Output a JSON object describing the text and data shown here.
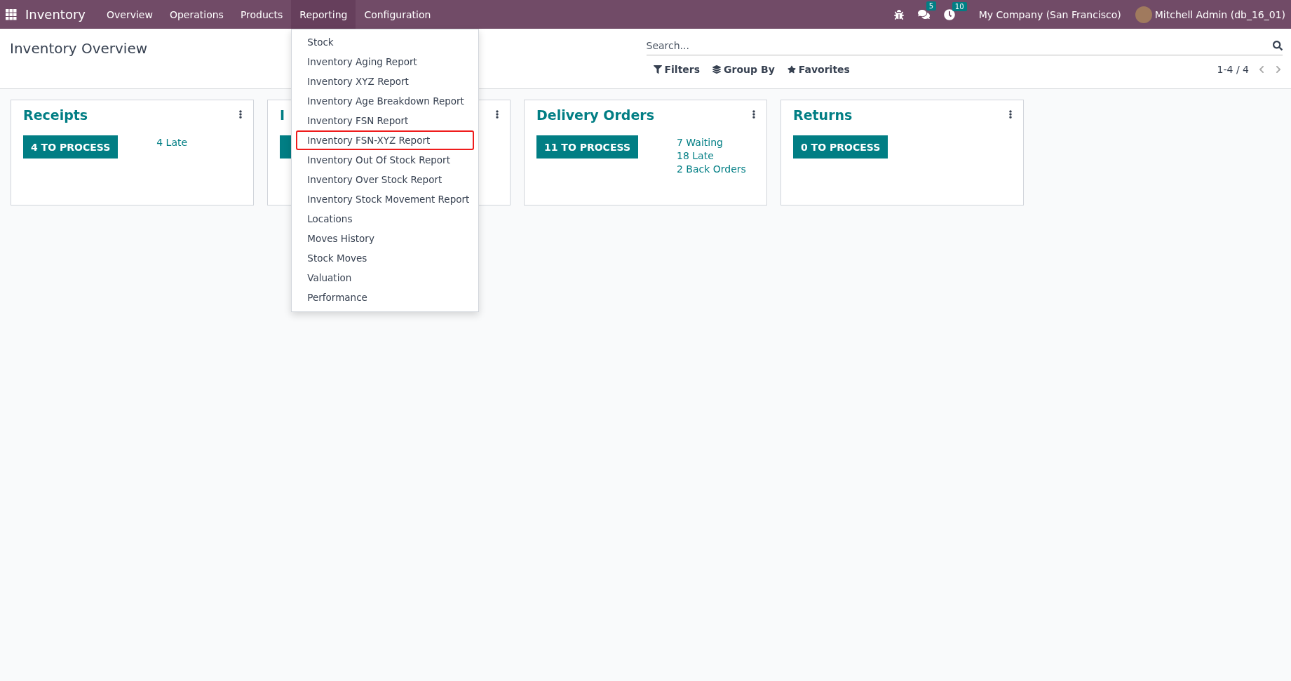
{
  "navbar": {
    "app_name": "Inventory",
    "menus": [
      {
        "label": "Overview",
        "selected": false
      },
      {
        "label": "Operations",
        "selected": false
      },
      {
        "label": "Products",
        "selected": false
      },
      {
        "label": "Reporting",
        "selected": true
      },
      {
        "label": "Configuration",
        "selected": false
      }
    ],
    "messages_badge": "5",
    "activities_badge": "10",
    "company": "My Company (San Francisco)",
    "user": "Mitchell Admin (db_16_01)"
  },
  "dropdown": {
    "items": [
      {
        "label": "Stock",
        "highlighted": false
      },
      {
        "label": "Inventory Aging Report",
        "highlighted": false
      },
      {
        "label": "Inventory XYZ Report",
        "highlighted": false
      },
      {
        "label": "Inventory Age Breakdown Report",
        "highlighted": false
      },
      {
        "label": "Inventory FSN Report",
        "highlighted": false
      },
      {
        "label": "Inventory FSN-XYZ Report",
        "highlighted": true
      },
      {
        "label": "Inventory Out Of Stock Report",
        "highlighted": false
      },
      {
        "label": "Inventory Over Stock Report",
        "highlighted": false
      },
      {
        "label": "Inventory Stock Movement Report",
        "highlighted": false
      },
      {
        "label": "Locations",
        "highlighted": false
      },
      {
        "label": "Moves History",
        "highlighted": false
      },
      {
        "label": "Stock Moves",
        "highlighted": false
      },
      {
        "label": "Valuation",
        "highlighted": false
      },
      {
        "label": "Performance",
        "highlighted": false
      }
    ]
  },
  "control_panel": {
    "title": "Inventory Overview",
    "search": {
      "placeholder": "Search..."
    },
    "filters": [
      "Filters",
      "Group By",
      "Favorites"
    ],
    "pager": "1-4 / 4"
  },
  "cards": [
    {
      "title": "Receipts",
      "kind": "process",
      "button_label": "4 TO PROCESS",
      "stats": [
        "4 Late"
      ]
    },
    {
      "title": "I",
      "kind": "process"
    },
    {
      "title": "Delivery Orders",
      "kind": "process",
      "button_label": "11 TO PROCESS",
      "stats": [
        "7 Waiting",
        "18 Late",
        "2 Back Orders"
      ]
    },
    {
      "title": "Returns",
      "kind": "process",
      "button_label": "0 TO PROCESS"
    }
  ]
}
